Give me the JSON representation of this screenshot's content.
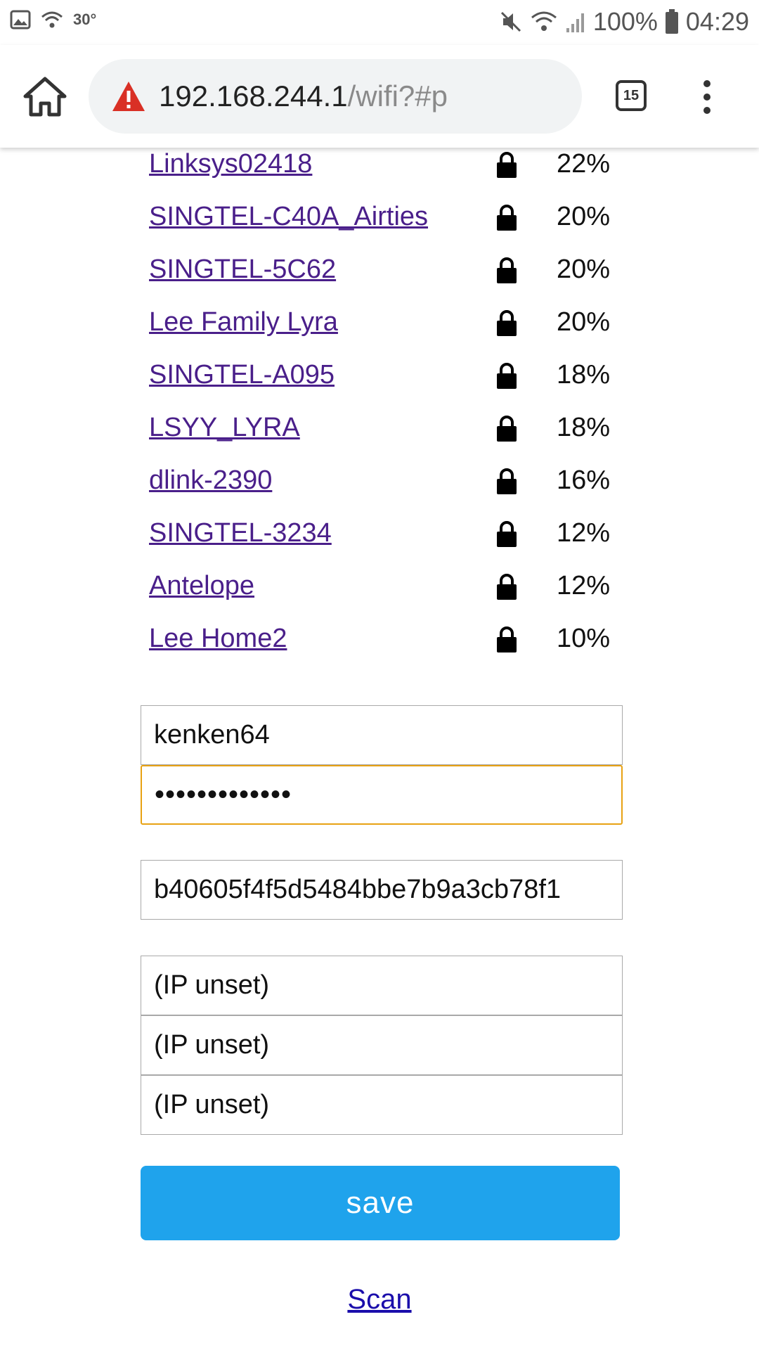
{
  "status_bar": {
    "temperature": "30°",
    "battery": "100%",
    "time": "04:29"
  },
  "browser": {
    "url_host": "192.168.244.1",
    "url_path": "/wifi?#p",
    "tab_count": "15",
    "icons": [
      "home-icon",
      "warning-icon",
      "tab-switcher-icon",
      "more-vert-icon"
    ]
  },
  "networks": [
    {
      "ssid": "Linksys02418",
      "secured": true,
      "signal": "22%"
    },
    {
      "ssid": "SINGTEL-C40A_Airties",
      "secured": true,
      "signal": "20%"
    },
    {
      "ssid": "SINGTEL-5C62",
      "secured": true,
      "signal": "20%"
    },
    {
      "ssid": "Lee Family Lyra",
      "secured": true,
      "signal": "20%"
    },
    {
      "ssid": "SINGTEL-A095",
      "secured": true,
      "signal": "18%"
    },
    {
      "ssid": "LSYY_LYRA",
      "secured": true,
      "signal": "18%"
    },
    {
      "ssid": "dlink-2390",
      "secured": true,
      "signal": "16%"
    },
    {
      "ssid": "SINGTEL-3234",
      "secured": true,
      "signal": "12%"
    },
    {
      "ssid": "Antelope",
      "secured": true,
      "signal": "12%"
    },
    {
      "ssid": "Lee Home2",
      "secured": true,
      "signal": "10%"
    }
  ],
  "form": {
    "ssid_value": "kenken64",
    "password_value": "•••••••••••••",
    "token_value": "b40605f4f5d5484bbe7b9a3cb78f1",
    "ip_fields": [
      "(IP unset)",
      "(IP unset)",
      "(IP unset)"
    ],
    "save_label": "save",
    "scan_label": "Scan"
  },
  "colors": {
    "link_visited": "#4a1f8a",
    "focus_border": "#e8a213",
    "save_button": "#1fa3ec",
    "scan_link": "#1a0dab",
    "warning": "#d93025"
  }
}
